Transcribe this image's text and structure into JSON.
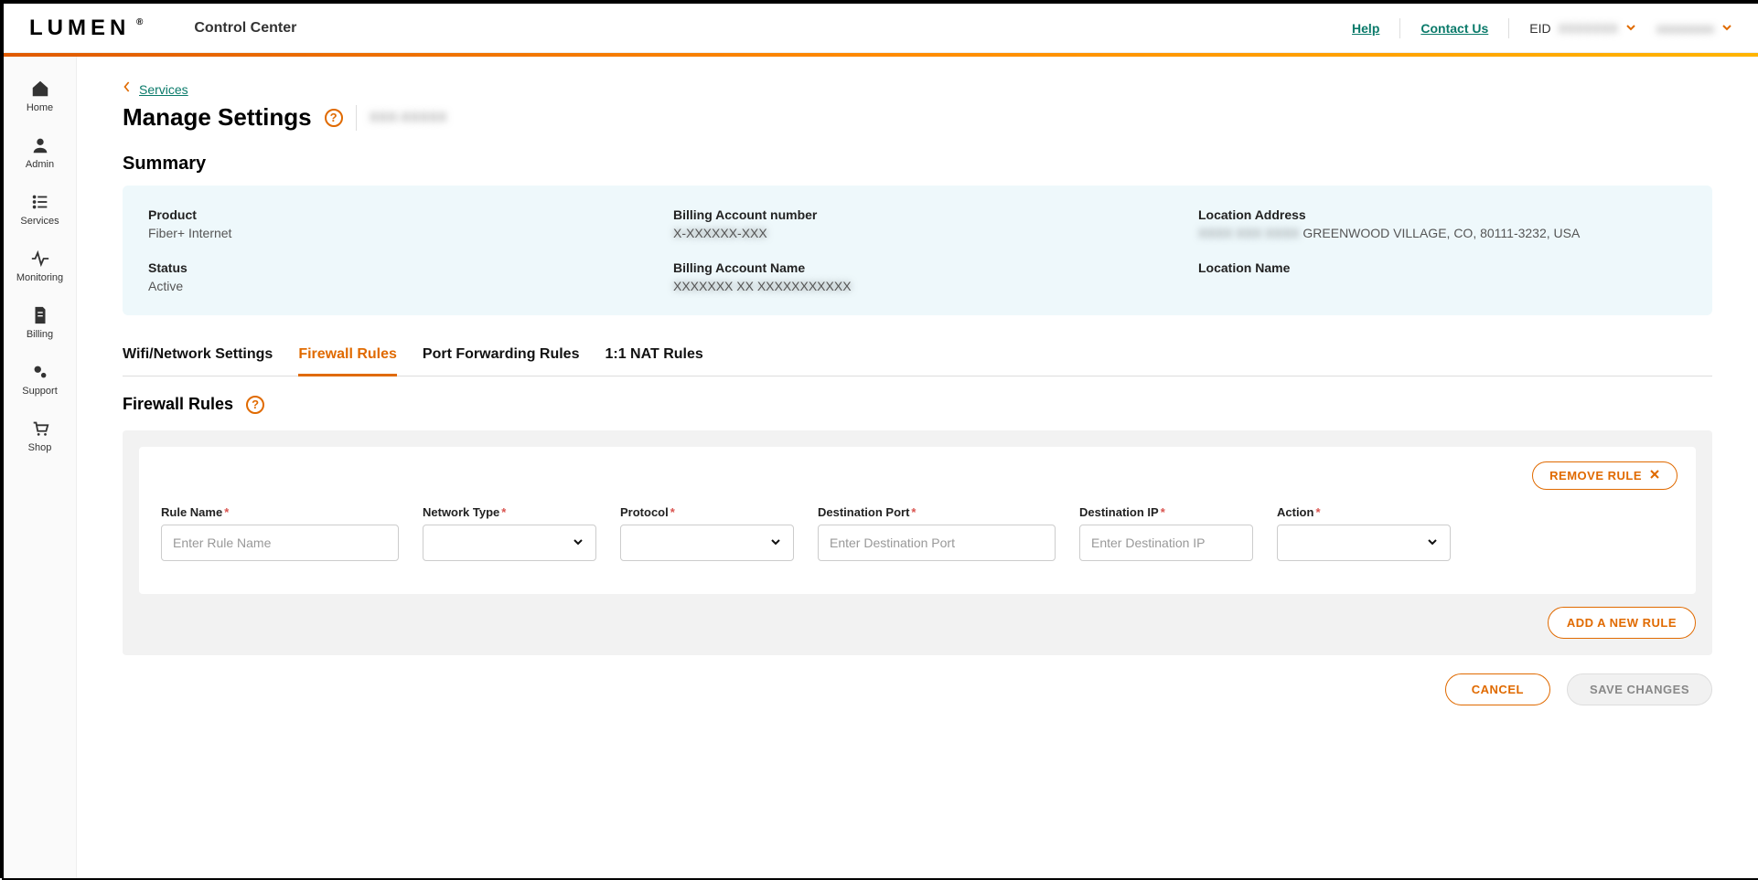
{
  "header": {
    "brand": "LUMEN",
    "brand_mark": "®",
    "app_title": "Control Center",
    "help_label": "Help",
    "contact_label": "Contact Us",
    "eid_label": "EID",
    "eid_value_masked": "XXXXXXX",
    "user_name_masked": "xxxxxxxxx"
  },
  "sidebar": {
    "items": [
      {
        "label": "Home"
      },
      {
        "label": "Admin"
      },
      {
        "label": "Services"
      },
      {
        "label": "Monitoring"
      },
      {
        "label": "Billing"
      },
      {
        "label": "Support"
      },
      {
        "label": "Shop"
      }
    ]
  },
  "breadcrumb": {
    "back_label": "Services"
  },
  "page": {
    "title": "Manage Settings",
    "subtitle_masked": "XXX-XXXXX"
  },
  "summary": {
    "heading": "Summary",
    "product_label": "Product",
    "product_value": "Fiber+ Internet",
    "status_label": "Status",
    "status_value": "Active",
    "ban_label": "Billing Account number",
    "ban_value_masked": "X-XXXXXX-XXX",
    "ban_name_label": "Billing Account Name",
    "ban_name_value_masked": "XXXXXXX XX XXXXXXXXXXX",
    "loc_addr_label": "Location Address",
    "loc_addr_value_masked": "XXXX XXX XXXX",
    "loc_addr_value_visible": " GREENWOOD VILLAGE, CO, 80111-3232, USA",
    "loc_name_label": "Location Name",
    "loc_name_value": ""
  },
  "tabs": {
    "t0": "Wifi/Network Settings",
    "t1": "Firewall Rules",
    "t2": "Port Forwarding Rules",
    "t3": "1:1 NAT Rules",
    "active_index": 1
  },
  "panel": {
    "title": "Firewall Rules"
  },
  "rule_card": {
    "remove_label": "REMOVE RULE",
    "fields": {
      "rule_name": {
        "label": "Rule Name",
        "placeholder": "Enter Rule Name",
        "value": ""
      },
      "network_type": {
        "label": "Network Type",
        "value": ""
      },
      "protocol": {
        "label": "Protocol",
        "value": ""
      },
      "dest_port": {
        "label": "Destination Port",
        "placeholder": "Enter Destination Port",
        "value": ""
      },
      "dest_ip": {
        "label": "Destination IP",
        "placeholder": "Enter Destination IP",
        "value": ""
      },
      "action": {
        "label": "Action",
        "value": ""
      }
    }
  },
  "buttons": {
    "add_rule": "ADD A NEW RULE",
    "cancel": "CANCEL",
    "save": "SAVE CHANGES"
  },
  "colors": {
    "accent": "#e06a00",
    "teal_link": "#0a7a6a",
    "summary_bg": "#eef8fb"
  }
}
